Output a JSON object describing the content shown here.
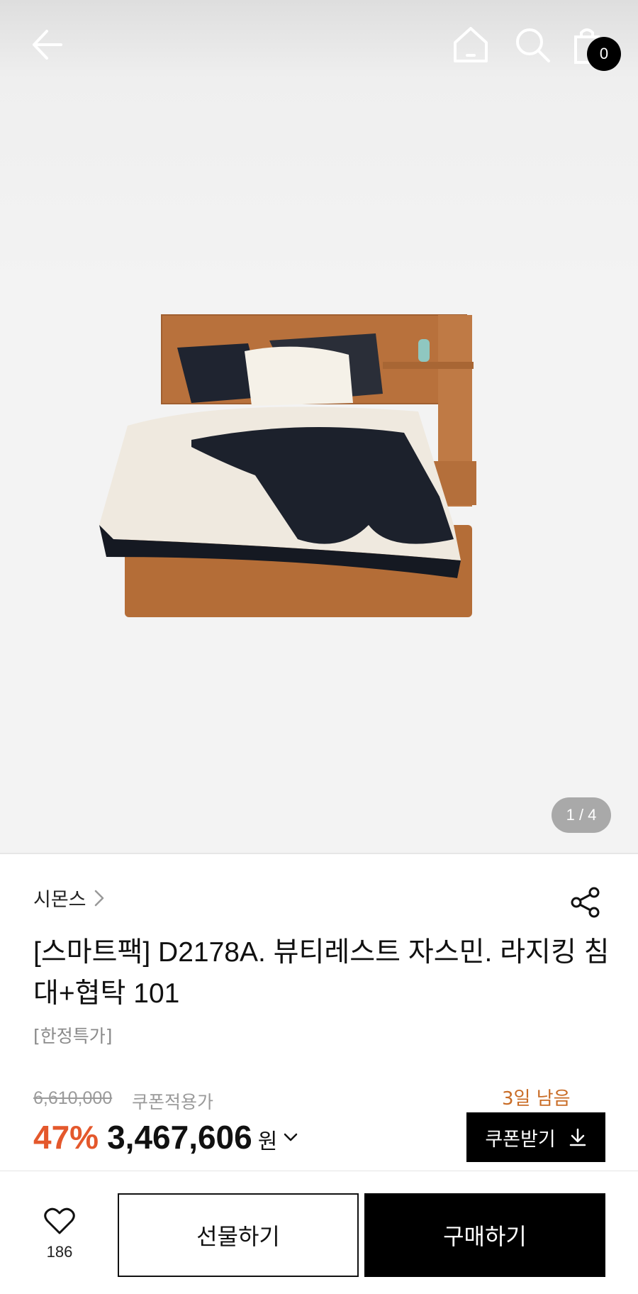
{
  "header": {
    "back_icon": "arrow-left-icon",
    "home_icon": "home-icon",
    "search_icon": "search-icon",
    "cart_icon": "shopping-bag-icon",
    "cart_count": "0"
  },
  "gallery": {
    "pager": "1 / 4",
    "current": 1,
    "total": 4
  },
  "product": {
    "brand": "시몬스",
    "title": "[스마트팩] D2178A. 뷰티레스트 자스민. 라지킹 침대+협탁 101",
    "subtitle": "[한정특가]"
  },
  "pricing": {
    "original_price": "6,610,000",
    "coupon_label": "쿠폰적용가",
    "days_left": "3일 남음",
    "discount": "47%",
    "price": "3,467,606",
    "currency": "원",
    "coupon_button": "쿠폰받기"
  },
  "bottom_bar": {
    "wish_count": "186",
    "gift_label": "선물하기",
    "buy_label": "구매하기"
  },
  "colors": {
    "accent_discount": "#e4582c",
    "days_left": "#c96c26",
    "primary_button": "#000000"
  }
}
